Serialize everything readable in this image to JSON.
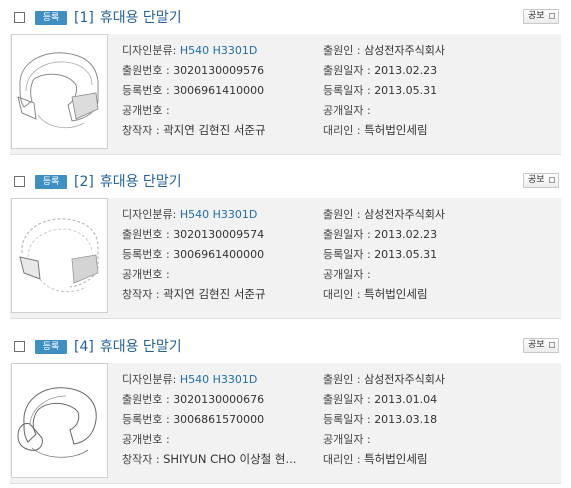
{
  "results": [
    {
      "badge": "등록",
      "number": "[1]",
      "title": "휴대용 단말기",
      "gongbo": "공보",
      "design_class_label": "디자인분류:",
      "design_class": "H540 H3301D",
      "applicant_label": "출원인 :",
      "applicant": "삼성전자주식회사",
      "app_no_label": "출원번호 :",
      "app_no": "3020130009576",
      "app_date_label": "출원일자 :",
      "app_date": "2013.02.23",
      "reg_no_label": "등록번호 :",
      "reg_no": "3006961410000",
      "reg_date_label": "등록일자 :",
      "reg_date": "2013.05.31",
      "pub_no_label": "공개번호 :",
      "pub_no": "",
      "pub_date_label": "공개일자 :",
      "pub_date": "",
      "creator_label": "창작자 :",
      "creator": "곽지연  김현진  서준규",
      "agent_label": "대리인 :",
      "agent": "특허법인세림"
    },
    {
      "badge": "등록",
      "number": "[2]",
      "title": "휴대용 단말기",
      "gongbo": "공보",
      "design_class_label": "디자인분류:",
      "design_class": "H540 H3301D",
      "applicant_label": "출원인 :",
      "applicant": "삼성전자주식회사",
      "app_no_label": "출원번호 :",
      "app_no": "3020130009574",
      "app_date_label": "출원일자 :",
      "app_date": "2013.02.23",
      "reg_no_label": "등록번호 :",
      "reg_no": "3006961400000",
      "reg_date_label": "등록일자 :",
      "reg_date": "2013.05.31",
      "pub_no_label": "공개번호 :",
      "pub_no": "",
      "pub_date_label": "공개일자 :",
      "pub_date": "",
      "creator_label": "창작자 :",
      "creator": "곽지연  김현진  서준규",
      "agent_label": "대리인 :",
      "agent": "특허법인세림"
    },
    {
      "badge": "등록",
      "number": "[4]",
      "title": "휴대용 단말기",
      "gongbo": "공보",
      "design_class_label": "디자인분류:",
      "design_class": "H540 H3301D",
      "applicant_label": "출원인 :",
      "applicant": "삼성전자주식회사",
      "app_no_label": "출원번호 :",
      "app_no": "3020130000676",
      "app_date_label": "출원일자 :",
      "app_date": "2013.01.04",
      "reg_no_label": "등록번호 :",
      "reg_no": "3006861570000",
      "reg_date_label": "등록일자 :",
      "reg_date": "2013.03.18",
      "pub_no_label": "공개번호 :",
      "pub_no": "",
      "pub_date_label": "공개일자 :",
      "pub_date": "",
      "creator_label": "창작자 :",
      "creator": "SHIYUN CHO 이상철 현...",
      "agent_label": "대리인 :",
      "agent": "특허법인세림"
    }
  ],
  "colors": {
    "badge": "#3f8fc2",
    "title": "#24639a",
    "link": "#1f6fa8",
    "card_bg": "#f2f2f2"
  },
  "icons": {
    "checkbox": "checkbox-square",
    "external": "external-link-icon"
  }
}
